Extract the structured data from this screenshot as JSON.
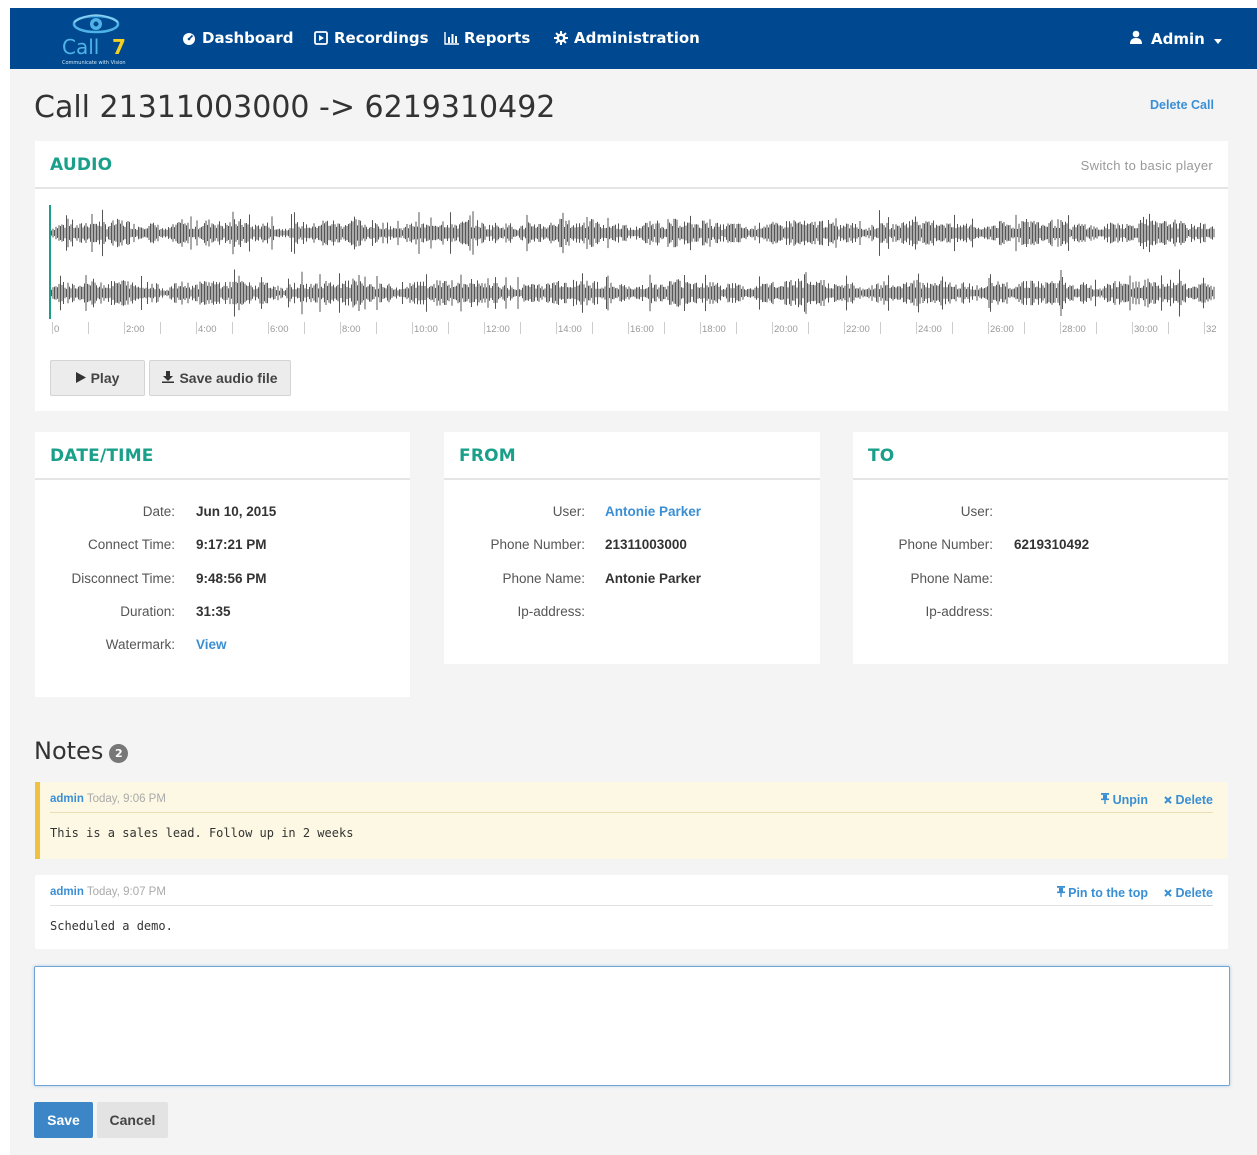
{
  "brand": {
    "logo_text": "Call 7",
    "tagline": "Communicate with Vision"
  },
  "nav": {
    "items": [
      {
        "label": "Dashboard",
        "icon": "dashboard-icon"
      },
      {
        "label": "Recordings",
        "icon": "recording-icon"
      },
      {
        "label": "Reports",
        "icon": "bar-chart-icon"
      },
      {
        "label": "Administration",
        "icon": "gear-icon"
      }
    ],
    "user_label": "Admin",
    "user_icon": "user-icon"
  },
  "page": {
    "title": "Call 21311003000 -> 6219310492",
    "delete_label": "Delete Call"
  },
  "audio": {
    "title": "AUDIO",
    "switch_label": "Switch to basic player",
    "timeline_labels": [
      "0",
      "2:00",
      "4:00",
      "6:00",
      "8:00",
      "10:00",
      "12:00",
      "14:00",
      "16:00",
      "18:00",
      "20:00",
      "22:00",
      "24:00",
      "26:00",
      "28:00",
      "30:00",
      "32"
    ],
    "play_label": "Play",
    "save_label": "Save audio file"
  },
  "datetime": {
    "title": "DATE/TIME",
    "rows": [
      {
        "label": "Date:",
        "value": "Jun 10, 2015"
      },
      {
        "label": "Connect Time:",
        "value": "9:17:21 PM"
      },
      {
        "label": "Disconnect Time:",
        "value": "9:48:56 PM"
      },
      {
        "label": "Duration:",
        "value": "31:35"
      },
      {
        "label": "Watermark:",
        "value": "View"
      }
    ]
  },
  "from": {
    "title": "FROM",
    "rows": [
      {
        "label": "User:",
        "value": "Antonie Parker"
      },
      {
        "label": "Phone Number:",
        "value": "21311003000"
      },
      {
        "label": "Phone Name:",
        "value": "Antonie Parker"
      },
      {
        "label": "Ip-address:",
        "value": ""
      }
    ]
  },
  "to": {
    "title": "TO",
    "rows": [
      {
        "label": "User:",
        "value": ""
      },
      {
        "label": "Phone Number:",
        "value": "6219310492"
      },
      {
        "label": "Phone Name:",
        "value": ""
      },
      {
        "label": "Ip-address:",
        "value": ""
      }
    ]
  },
  "notes": {
    "title": "Notes",
    "count": "2",
    "items": [
      {
        "author": "admin",
        "time": "Today, 9:06 PM",
        "text": "This is a sales lead. Follow up in 2 weeks",
        "pin_label": "Unpin",
        "delete_label": "Delete",
        "pinned": true
      },
      {
        "author": "admin",
        "time": "Today, 9:07 PM",
        "text": "Scheduled a demo.",
        "pin_label": "Pin to the top",
        "delete_label": "Delete",
        "pinned": false
      }
    ],
    "input_value": "",
    "save_label": "Save",
    "cancel_label": "Cancel"
  },
  "colors": {
    "navbar": "#004990",
    "accent_green": "#1aa08a",
    "link_blue": "#3a8fd4",
    "pinned_note_bg": "#fcf8e3",
    "pinned_note_border": "#f0c040",
    "playhead": "#1aa08a"
  }
}
